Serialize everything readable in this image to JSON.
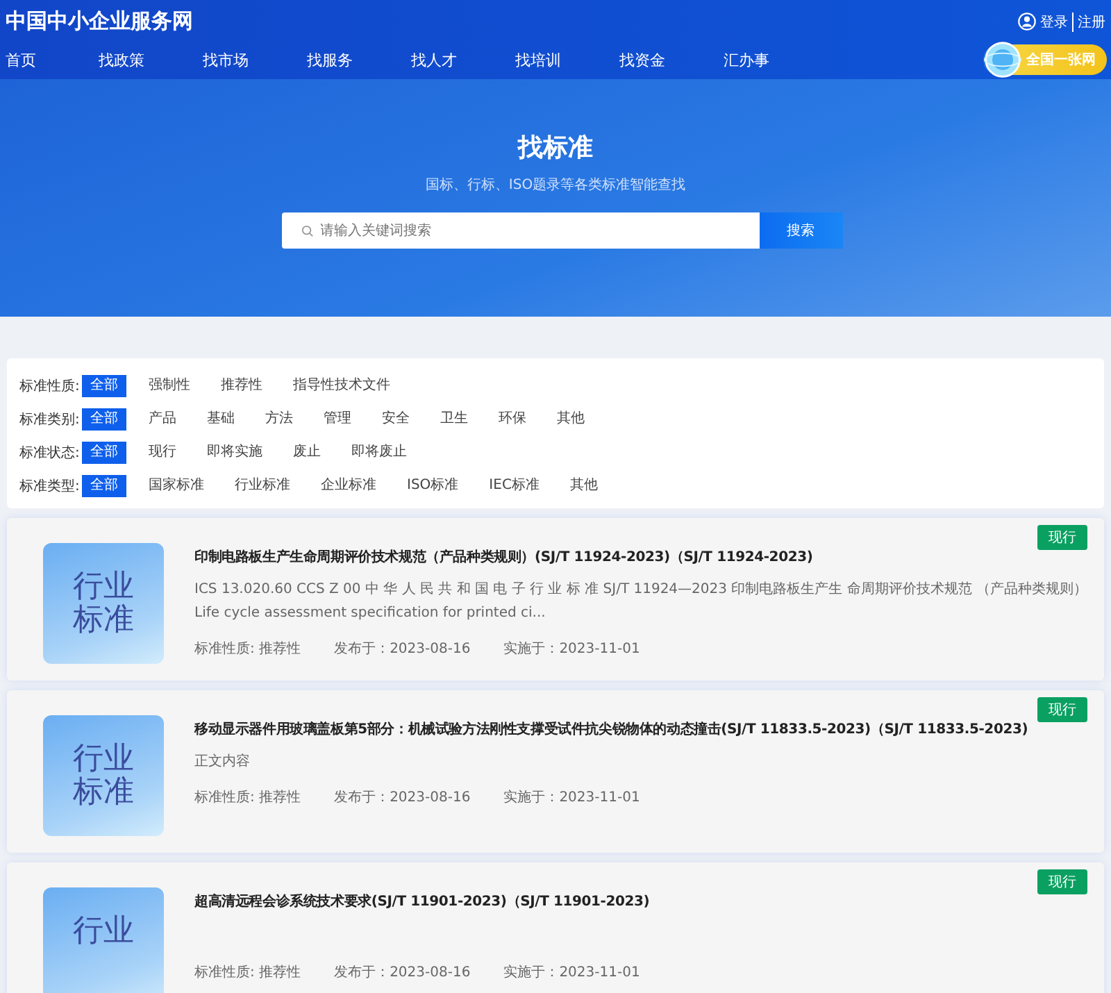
{
  "site": {
    "title": "中国中小企业服务网",
    "auth_links": [
      "登录",
      "注册"
    ],
    "network_badge": "全国一张网"
  },
  "nav": [
    {
      "label": "首页",
      "selected": false
    },
    {
      "label": "找政策",
      "selected": false
    },
    {
      "label": "找市场",
      "selected": false
    },
    {
      "label": "找服务",
      "selected": false
    },
    {
      "label": "找人才",
      "selected": false
    },
    {
      "label": "找培训",
      "selected": false
    },
    {
      "label": "找资金",
      "selected": false
    },
    {
      "label": "汇办事",
      "selected": false
    }
  ],
  "hero": {
    "title": "找标准",
    "subtitle": "国标、行标、ISO题录等各类标准智能查找",
    "search": {
      "placeholder": "请输入关键词搜索",
      "button": "搜索"
    }
  },
  "filters": [
    {
      "label": "标准性质:",
      "options": [
        {
          "label": "全部",
          "selected": true
        },
        {
          "label": "强制性",
          "selected": false
        },
        {
          "label": "推荐性",
          "selected": false
        },
        {
          "label": "指导性技术文件",
          "selected": false
        }
      ]
    },
    {
      "label": "标准类别:",
      "options": [
        {
          "label": "全部",
          "selected": true
        },
        {
          "label": "产品",
          "selected": false
        },
        {
          "label": "基础",
          "selected": false
        },
        {
          "label": "方法",
          "selected": false
        },
        {
          "label": "管理",
          "selected": false
        },
        {
          "label": "安全",
          "selected": false
        },
        {
          "label": "卫生",
          "selected": false
        },
        {
          "label": "环保",
          "selected": false
        },
        {
          "label": "其他",
          "selected": false
        }
      ]
    },
    {
      "label": "标准状态:",
      "options": [
        {
          "label": "全部",
          "selected": true
        },
        {
          "label": "现行",
          "selected": false
        },
        {
          "label": "即将实施",
          "selected": false
        },
        {
          "label": "废止",
          "selected": false
        },
        {
          "label": "即将废止",
          "selected": false
        }
      ]
    },
    {
      "label": "标准类型:",
      "options": [
        {
          "label": "全部",
          "selected": true
        },
        {
          "label": "国家标准",
          "selected": false
        },
        {
          "label": "行业标准",
          "selected": false
        },
        {
          "label": "企业标准",
          "selected": false
        },
        {
          "label": "ISO标准",
          "selected": false
        },
        {
          "label": "IEC标准",
          "selected": false
        },
        {
          "label": "其他",
          "selected": false
        }
      ]
    }
  ],
  "results": [
    {
      "thumb_lines": [
        "行业",
        "标准"
      ],
      "title": "印制电路板生产生命周期评价技术规范（产品种类规则）(SJ/T 11924-2023)（SJ/T 11924-2023)",
      "summary": "ICS 13.020.60 CCS Z 00 中 华 人 民 共 和 国 电 子 行 业 标 准 SJ/T 11924—2023 印制电路板生产生 命周期评价技术规范 （产品种类规则） Life cycle assessment specification for printed ci...",
      "nature": "标准性质: 推荐性",
      "published": "发布于：2023-08-16",
      "effective": "实施于：2023-11-01",
      "status": "现行"
    },
    {
      "thumb_lines": [
        "行业",
        "标准"
      ],
      "title": "移动显示器件用玻璃盖板第5部分：机械试验方法刚性支撑受试件抗尖锐物体的动态撞击(SJ/T 11833.5-2023)（SJ/T 11833.5-2023)",
      "summary": "正文内容",
      "nature": "标准性质: 推荐性",
      "published": "发布于：2023-08-16",
      "effective": "实施于：2023-11-01",
      "status": "现行"
    },
    {
      "thumb_lines": [
        "行业"
      ],
      "title": "超高清远程会诊系统技术要求(SJ/T 11901-2023)（SJ/T 11901-2023)",
      "nature": "标准性质: 推荐性",
      "published": "发布于：2023-08-16",
      "effective": "实施于：2023-11-01",
      "status": "现行"
    }
  ]
}
